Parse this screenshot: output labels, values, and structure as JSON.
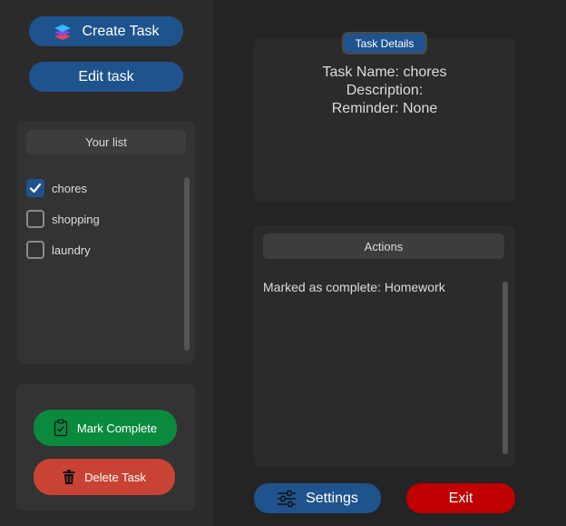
{
  "sidebar": {
    "create_task_label": "Create Task",
    "edit_task_label": "Edit task",
    "list_header": "Your list",
    "tasks": [
      {
        "label": "chores",
        "checked": true
      },
      {
        "label": "shopping",
        "checked": false
      },
      {
        "label": "laundry",
        "checked": false
      }
    ],
    "mark_complete_label": "Mark Complete",
    "delete_task_label": "Delete Task"
  },
  "details": {
    "tag": "Task Details",
    "task_name": "Task Name: chores",
    "description": "Description:",
    "reminder": "Reminder: None"
  },
  "actions": {
    "header": "Actions",
    "log": [
      "Marked as complete: Homework"
    ]
  },
  "footer": {
    "settings_label": "Settings",
    "exit_label": "Exit"
  },
  "icons": {
    "create": "layers-icon",
    "mark_complete": "clipboard-check-icon",
    "delete": "trash-icon",
    "settings": "sliders-icon",
    "check": "checkmark-icon"
  },
  "colors": {
    "accent_blue": "#1f538d",
    "complete_green": "#0a8a3e",
    "delete_red": "#c94335",
    "exit_red": "#c00000",
    "background": "#242424"
  }
}
